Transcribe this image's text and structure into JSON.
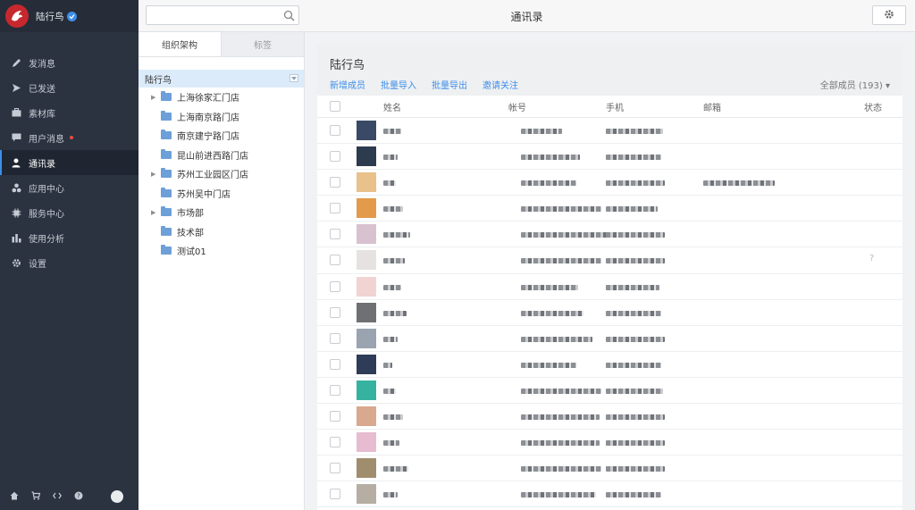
{
  "sidebar": {
    "brand": "陆行鸟",
    "items": [
      {
        "label": "发消息",
        "icon": "pencil-icon"
      },
      {
        "label": "已发送",
        "icon": "send-icon"
      },
      {
        "label": "素材库",
        "icon": "briefcase-icon"
      },
      {
        "label": "用户消息",
        "icon": "chat-icon",
        "badge": true
      },
      {
        "label": "通讯录",
        "icon": "person-icon",
        "active": true
      },
      {
        "label": "应用中心",
        "icon": "apps-icon"
      },
      {
        "label": "服务中心",
        "icon": "service-icon"
      },
      {
        "label": "使用分析",
        "icon": "chart-icon"
      },
      {
        "label": "设置",
        "icon": "gear-icon"
      }
    ],
    "footer_icons": [
      "home-icon",
      "cart-icon",
      "code-icon",
      "help-icon",
      "add-icon"
    ]
  },
  "topbar": {
    "search_placeholder": "",
    "title": "通讯录"
  },
  "org": {
    "tabs": [
      "组织架构",
      "标签"
    ],
    "root": "陆行鸟",
    "departments": [
      {
        "label": "上海徐家汇门店",
        "expandable": true
      },
      {
        "label": "上海南京路门店",
        "expandable": false
      },
      {
        "label": "南京建宁路门店",
        "expandable": false
      },
      {
        "label": "昆山前进西路门店",
        "expandable": false
      },
      {
        "label": "苏州工业园区门店",
        "expandable": true
      },
      {
        "label": "苏州吴中门店",
        "expandable": false
      },
      {
        "label": "市场部",
        "expandable": true
      },
      {
        "label": "技术部",
        "expandable": false
      },
      {
        "label": "测试01",
        "expandable": false
      }
    ]
  },
  "main": {
    "group_title": "陆行鸟",
    "actions": [
      "新增成员",
      "批量导入",
      "批量导出",
      "邀请关注"
    ],
    "members_filter": "全部成员 (193) ▾",
    "columns": [
      "姓名",
      "帐号",
      "手机",
      "邮箱",
      "状态"
    ],
    "row_count": 15,
    "status_mark": "?"
  },
  "colors": {
    "sidebar_bg": "#2b3340",
    "accent": "#3d8eea",
    "brand_red": "#c7282e"
  }
}
